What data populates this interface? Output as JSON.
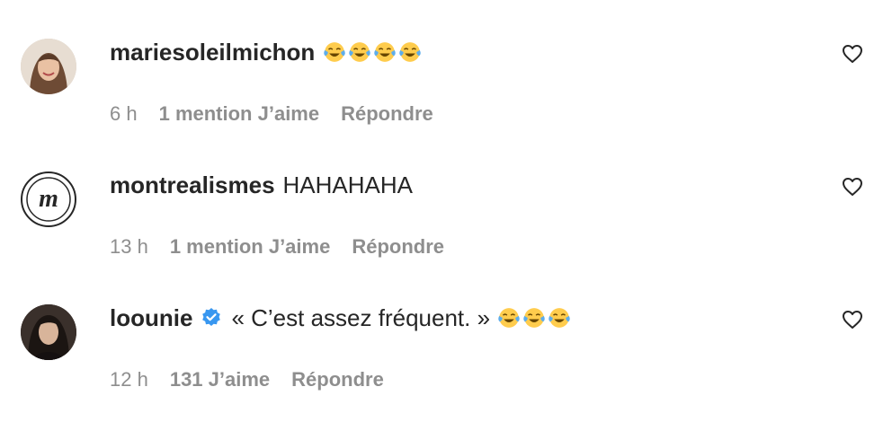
{
  "comments": [
    {
      "username": "mariesoleilmichon",
      "text": "",
      "emoji": "face-with-tears-of-joy",
      "emoji_count": 4,
      "time": "6 h",
      "likes": "1 mention J’aime",
      "reply": "Répondre",
      "verified": false
    },
    {
      "username": "montrealismes",
      "text": "HAHAHAHA",
      "time": "13 h",
      "likes": "1 mention J’aime",
      "reply": "Répondre",
      "verified": false
    },
    {
      "username": "loounie",
      "text": "« C’est assez fréquent. »",
      "emoji": "face-with-tears-of-joy",
      "emoji_count": 3,
      "time": "12 h",
      "likes": "131 J’aime",
      "reply": "Répondre",
      "verified": true
    }
  ],
  "icons": {
    "like": "heart-icon",
    "verified": "verified-badge-icon"
  },
  "colors": {
    "text": "#262626",
    "meta": "#8e8e8e",
    "verified": "#3897f0"
  }
}
